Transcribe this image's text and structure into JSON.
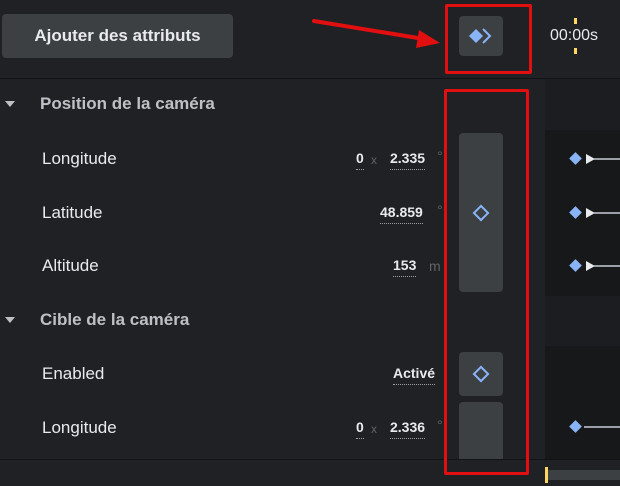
{
  "toolbar": {
    "add_attributes_label": "Ajouter des attributs",
    "time_label": "00:00s"
  },
  "sections": [
    {
      "title": "Position de la caméra",
      "rows": [
        {
          "label": "Longitude",
          "value_a": "0",
          "sep": "x",
          "value": "2.335",
          "unit": "°"
        },
        {
          "label": "Latitude",
          "value": "48.859",
          "unit": "°"
        },
        {
          "label": "Altitude",
          "value": "153",
          "unit": "m"
        }
      ]
    },
    {
      "title": "Cible de la caméra",
      "rows": [
        {
          "label": "Enabled",
          "value": "Activé"
        },
        {
          "label": "Longitude",
          "value_a": "0",
          "sep": "x",
          "value": "2.336",
          "unit": "°"
        }
      ]
    }
  ],
  "colors": {
    "background": "#202124",
    "button": "#3c4043",
    "accent_keyframe": "#8ab4f8",
    "time_marker": "#fdd663",
    "annotation": "#e10f0f"
  },
  "icons": {
    "top_keyframe": "double-diamond-icon",
    "row_keyframe": "diamond-outline-icon",
    "timeline_key": "diamond-filled-icon",
    "collapse": "triangle-down-icon"
  }
}
